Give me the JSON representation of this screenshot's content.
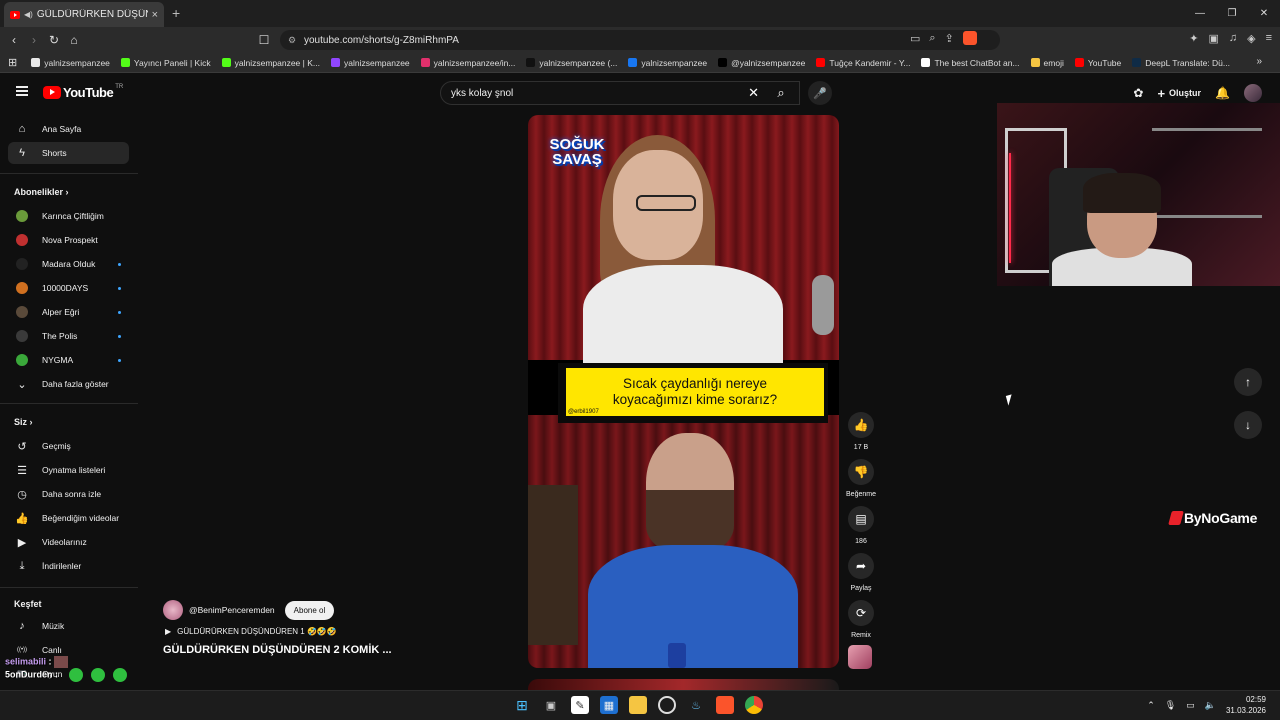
{
  "browser": {
    "tab_title": "GÜLDÜRÜRKEN DÜŞÜNDÜR",
    "tab_close": "×",
    "new_tab": "+",
    "url": "youtube.com/shorts/g-Z8miRhmPA",
    "window_controls": {
      "minimize": "—",
      "maximize": "❐",
      "close": "✕"
    }
  },
  "bookmarks": [
    {
      "label": "yalnizsempanzee",
      "icon_color": "#e8e8e8"
    },
    {
      "label": "Yayıncı Paneli | Kick",
      "icon_color": "#53fc18"
    },
    {
      "label": "yalnizsempanzee | K...",
      "icon_color": "#53fc18"
    },
    {
      "label": "yalnizsempanzee",
      "icon_color": "#9146ff"
    },
    {
      "label": "yalnizsempanzee/in...",
      "icon_color": "#e1306c"
    },
    {
      "label": "yalnizsempanzee (...",
      "icon_color": "#111111"
    },
    {
      "label": "yalnizsempanzee",
      "icon_color": "#1877f2"
    },
    {
      "label": "@yalnizsempanzee",
      "icon_color": "#000000"
    },
    {
      "label": "Tuğçe Kandemir - Y...",
      "icon_color": "#ff0000"
    },
    {
      "label": "The best ChatBot an...",
      "icon_color": "#ffffff"
    },
    {
      "label": "emoji",
      "icon_color": "#f5c542"
    },
    {
      "label": "YouTube",
      "icon_color": "#ff0000"
    },
    {
      "label": "DeepL Translate: Dü...",
      "icon_color": "#0f2b46"
    }
  ],
  "youtube": {
    "logo": "YouTube",
    "region": "TR",
    "search_value": "yks kolay şnol",
    "create_label": "Oluştur",
    "accent": "#ff0000"
  },
  "sidebar": {
    "main": [
      {
        "label": "Ana Sayfa",
        "icon": "home-icon"
      },
      {
        "label": "Shorts",
        "icon": "shorts-icon",
        "active": true
      }
    ],
    "subscriptions_title": "Abonelikler",
    "subscriptions": [
      {
        "label": "Karınca Çiftliğim",
        "color": "#6a9a3a",
        "new": false
      },
      {
        "label": "Nova Prospekt",
        "color": "#c03030",
        "new": false
      },
      {
        "label": "Madara Olduk",
        "color": "#222222",
        "new": true
      },
      {
        "label": "10000DAYS",
        "color": "#d07020",
        "new": true
      },
      {
        "label": "Alper Eğri",
        "color": "#5a4a3a",
        "new": true
      },
      {
        "label": "The Polis",
        "color": "#3a3a3a",
        "new": true
      },
      {
        "label": "NYGMA",
        "color": "#3aa83a",
        "new": true
      }
    ],
    "show_more": "Daha fazla göster",
    "you_title": "Siz",
    "you": [
      {
        "label": "Geçmiş",
        "icon": "history-icon"
      },
      {
        "label": "Oynatma listeleri",
        "icon": "playlists-icon"
      },
      {
        "label": "Daha sonra izle",
        "icon": "watch-later-icon"
      },
      {
        "label": "Beğendiğim videolar",
        "icon": "liked-icon"
      },
      {
        "label": "Videolarınız",
        "icon": "your-videos-icon"
      },
      {
        "label": "İndirilenler",
        "icon": "downloads-icon"
      }
    ],
    "explore_title": "Keşfet",
    "explore": [
      {
        "label": "Müzik",
        "icon": "music-icon"
      },
      {
        "label": "Canlı",
        "icon": "live-icon"
      },
      {
        "label": "Oyun",
        "icon": "gaming-icon"
      }
    ]
  },
  "short": {
    "brand_logo": "SOĞUK SAVAŞ",
    "caption_line1": "Sıcak çaydanlığı nereye",
    "caption_line2": "koyacağımızı kime sorarız?",
    "caption_credit": "@erbil1907",
    "channel": "@BenimPenceremden",
    "subscribe": "Abone ol",
    "playlist": "GÜLDÜRÜRKEN DÜŞÜNDÜREN 1 🤣🤣🤣",
    "title": "GÜLDÜRÜRKEN DÜŞÜNDÜREN 2 KOMİK ...",
    "likes": "17 B",
    "dislike_label": "Beğenme",
    "comments": "186",
    "share_label": "Paylaş",
    "remix_label": "Remix"
  },
  "overlay": {
    "watermark": "ByNoGame",
    "chat": [
      {
        "name": "selimabili",
        "text": ""
      },
      {
        "name": "5onDurden",
        "text": ""
      }
    ]
  },
  "taskbar": {
    "time": "02:59",
    "date": "31.03.2026"
  }
}
